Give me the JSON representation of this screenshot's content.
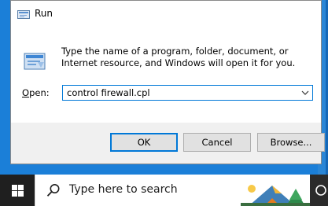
{
  "dialog": {
    "title": "Run",
    "instructions": "Type the name of a program, folder, document, or Internet resource, and Windows will open it for you.",
    "open_label_accel": "O",
    "open_label_rest": "pen:",
    "open_value": "control firewall.cpl",
    "ok_label": "OK",
    "cancel_label": "Cancel",
    "browse_label": "Browse..."
  },
  "taskbar": {
    "search_placeholder": "Type here to search"
  },
  "icons": {
    "title": "run-icon",
    "body": "run-program-icon",
    "dropdown": "chevron-down-icon",
    "start": "windows-logo-icon",
    "search": "search-icon",
    "cortana": "cortana-icon"
  },
  "colors": {
    "accent": "#0078d7",
    "desktop": "#1b7fd8",
    "dialog_bg": "#f0f0f0",
    "taskbar_bg": "#f3f3f3"
  }
}
